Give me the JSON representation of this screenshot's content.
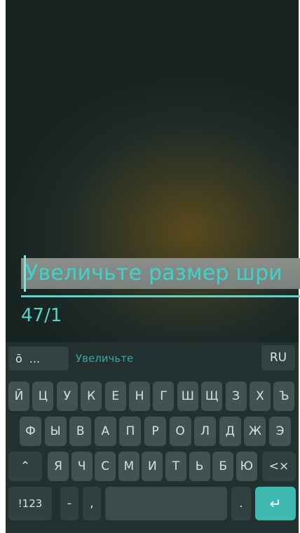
{
  "text_field": {
    "value": "Увеличьте размер шри",
    "counter": "47/1"
  },
  "keyboard": {
    "suggestion_left": "...",
    "suggestion_word": "Увеличьте",
    "lang": "RU",
    "row1": [
      "Й",
      "Ц",
      "У",
      "К",
      "Е",
      "Н",
      "Г",
      "Ш",
      "Щ",
      "З",
      "Х",
      "Ъ"
    ],
    "row2": [
      "Ф",
      "Ы",
      "В",
      "А",
      "П",
      "Р",
      "О",
      "Л",
      "Д",
      "Ж",
      "Э"
    ],
    "row3": [
      "Я",
      "Ч",
      "С",
      "М",
      "И",
      "Т",
      "Ь",
      "Б",
      "Ю"
    ],
    "shift_icon": "⌃",
    "backspace_icon": "<×",
    "numbers_key": "!123",
    "dash_key": "-",
    "comma_key": ",",
    "period_key": ".",
    "enter_icon": "↵",
    "clipboard_icon": "ō",
    "accent_color": "#3fb9b2"
  }
}
